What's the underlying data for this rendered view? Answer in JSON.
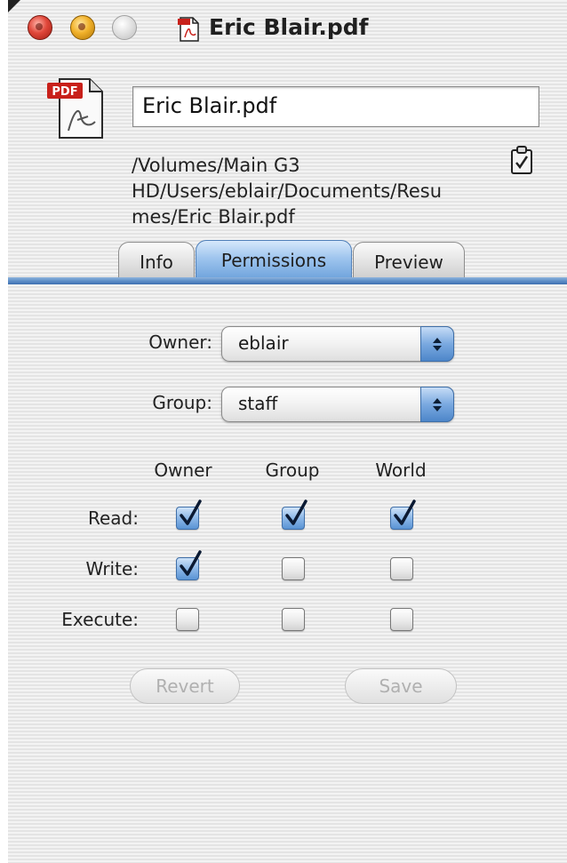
{
  "window": {
    "title": "Eric Blair.pdf"
  },
  "file": {
    "name": "Eric Blair.pdf",
    "path_lines": [
      "/Volumes/Main G3",
      "HD/Users/eblair/Documents/Resu",
      "mes/Eric Blair.pdf"
    ],
    "icon_badge": "PDF"
  },
  "tabs": [
    {
      "label": "Info",
      "selected": false
    },
    {
      "label": "Permissions",
      "selected": true
    },
    {
      "label": "Preview",
      "selected": false
    }
  ],
  "permissions": {
    "owner_label": "Owner:",
    "owner_value": "eblair",
    "group_label": "Group:",
    "group_value": "staff",
    "columns": [
      "Owner",
      "Group",
      "World"
    ],
    "rows": [
      {
        "label": "Read:",
        "values": [
          true,
          true,
          true
        ]
      },
      {
        "label": "Write:",
        "values": [
          true,
          false,
          false
        ]
      },
      {
        "label": "Execute:",
        "values": [
          false,
          false,
          false
        ]
      }
    ]
  },
  "buttons": {
    "revert": "Revert",
    "save": "Save"
  },
  "colors": {
    "accent_blue": "#5e8fc8",
    "close": "#e0473a",
    "minimize": "#f1b12a"
  }
}
